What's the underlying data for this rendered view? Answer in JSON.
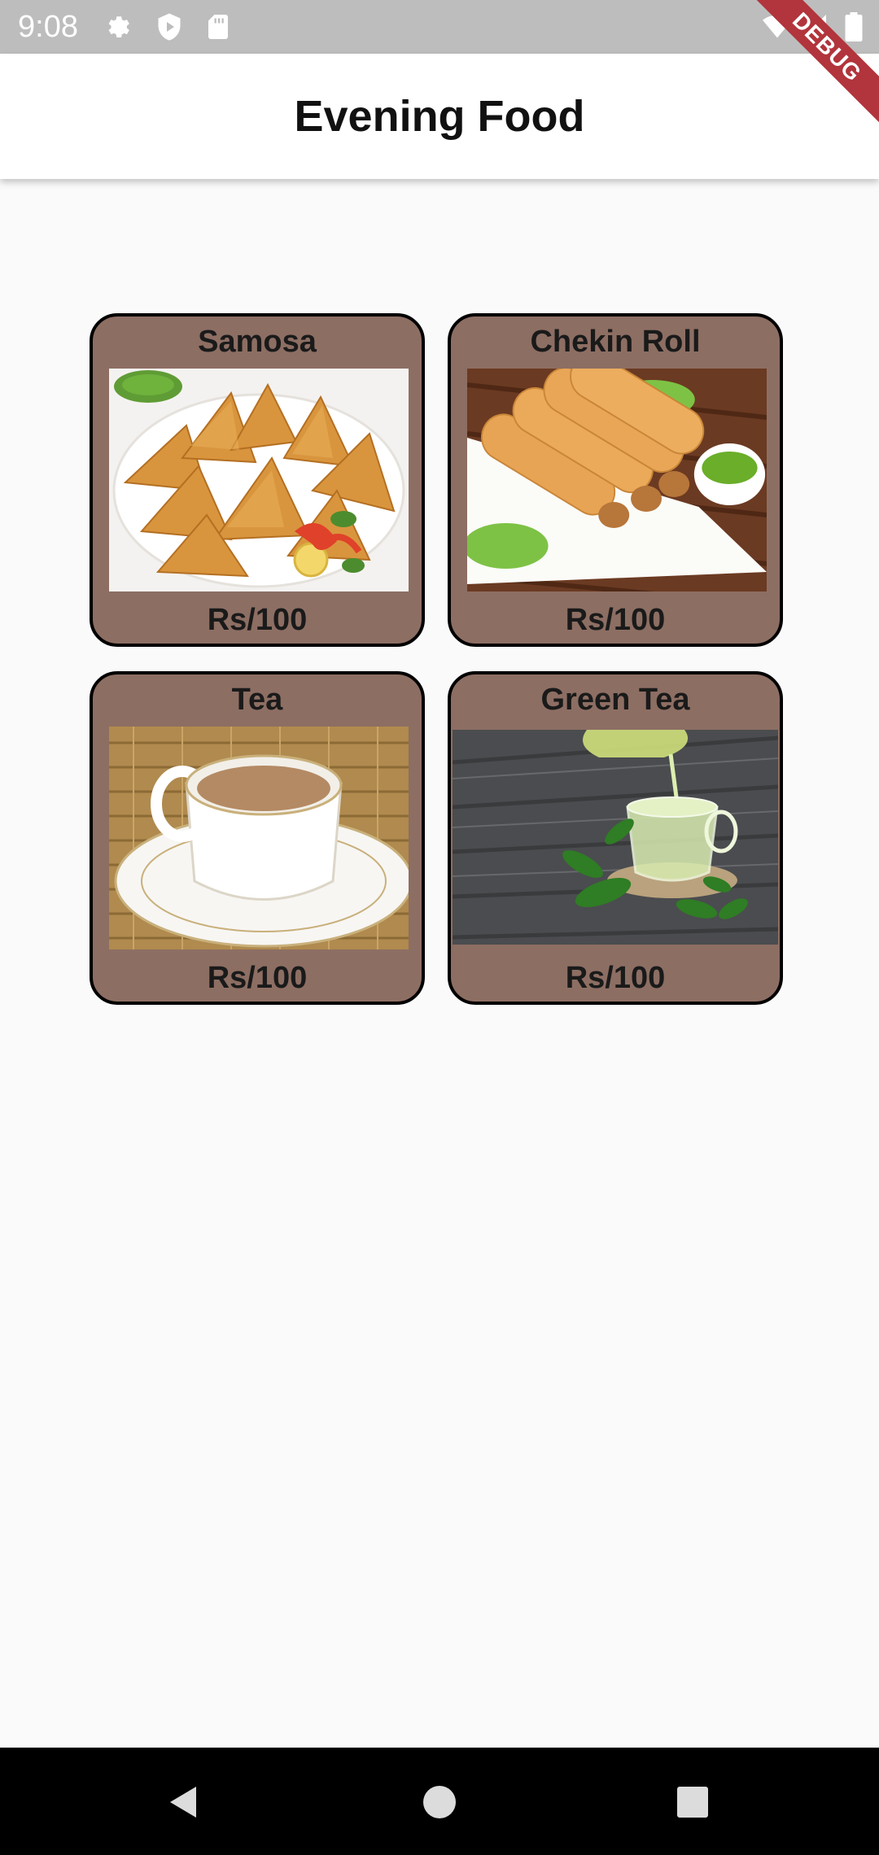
{
  "status_bar": {
    "time": "9:08",
    "left_icons": [
      "settings-icon",
      "play-protect-icon",
      "sd-card-icon"
    ],
    "right_icons": [
      "wifi-icon",
      "signal-icon",
      "battery-icon"
    ]
  },
  "debug_banner": "DEBUG",
  "app_bar": {
    "title": "Evening Food"
  },
  "items": [
    {
      "name": "Samosa",
      "price": "Rs/100",
      "image": "samosa-image"
    },
    {
      "name": "Chekin Roll",
      "price": "Rs/100",
      "image": "chicken-roll-image"
    },
    {
      "name": "Tea",
      "price": "Rs/100",
      "image": "tea-image"
    },
    {
      "name": "Green Tea",
      "price": "Rs/100",
      "image": "green-tea-image"
    }
  ],
  "colors": {
    "card_background": "#8d6e63",
    "card_border": "#000000",
    "page_background": "#fafafa",
    "status_bar": "#bdbdbd",
    "nav_bar": "#000000",
    "debug_banner": "#b2343c"
  },
  "navigation": [
    "back-icon",
    "home-icon",
    "recents-icon"
  ]
}
